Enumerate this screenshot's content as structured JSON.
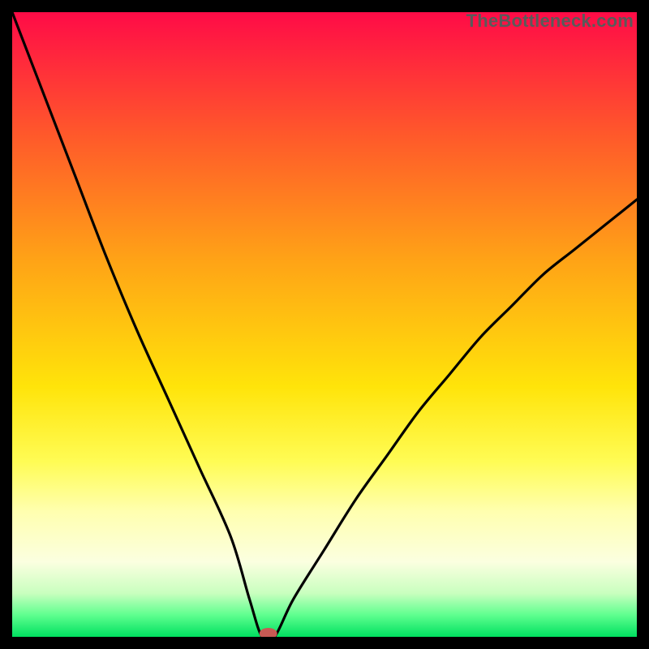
{
  "watermark": "TheBottleneck.com",
  "chart_data": {
    "type": "line",
    "title": "",
    "xlabel": "",
    "ylabel": "",
    "xlim": [
      0,
      100
    ],
    "ylim": [
      0,
      100
    ],
    "x": [
      0,
      5,
      10,
      15,
      20,
      25,
      30,
      35,
      38,
      40,
      42,
      45,
      50,
      55,
      60,
      65,
      70,
      75,
      80,
      85,
      90,
      95,
      100
    ],
    "values": [
      100,
      87,
      74,
      61,
      49,
      38,
      27,
      16,
      6,
      0,
      0,
      6,
      14,
      22,
      29,
      36,
      42,
      48,
      53,
      58,
      62,
      66,
      70
    ],
    "optimum_x": 41,
    "gradient_stops": [
      {
        "offset": 0.0,
        "color": "#ff0b47"
      },
      {
        "offset": 0.2,
        "color": "#ff5a2a"
      },
      {
        "offset": 0.4,
        "color": "#ffa416"
      },
      {
        "offset": 0.6,
        "color": "#ffe40a"
      },
      {
        "offset": 0.72,
        "color": "#fffc55"
      },
      {
        "offset": 0.8,
        "color": "#ffffb0"
      },
      {
        "offset": 0.88,
        "color": "#fbffe0"
      },
      {
        "offset": 0.93,
        "color": "#c9ffbf"
      },
      {
        "offset": 0.965,
        "color": "#5fff8f"
      },
      {
        "offset": 1.0,
        "color": "#00e060"
      }
    ],
    "marker": {
      "color": "#c85a54",
      "rx": 11,
      "ry": 7
    }
  }
}
